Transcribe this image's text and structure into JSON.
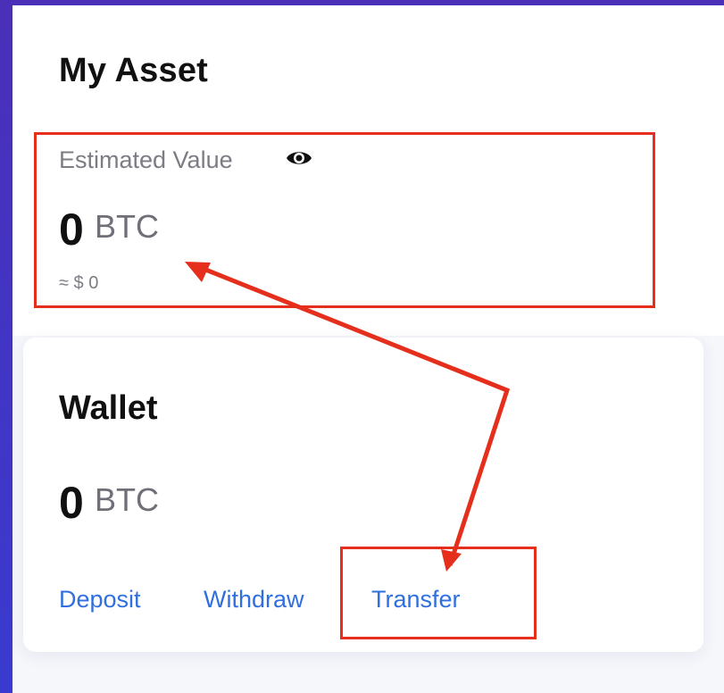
{
  "asset": {
    "title": "My Asset",
    "estimated_label": "Estimated Value",
    "amount": "0",
    "unit": "BTC",
    "fiat": "≈ $ 0",
    "visibility_icon": "eye-icon"
  },
  "wallet": {
    "title": "Wallet",
    "amount": "0",
    "unit": "BTC",
    "actions": {
      "deposit": "Deposit",
      "withdraw": "Withdraw",
      "transfer": "Transfer"
    }
  },
  "colors": {
    "link": "#2f6fe0",
    "annotation": "#e52e1c",
    "background_gradient_start": "#4a2fb8",
    "background_gradient_end": "#3a3ad0"
  }
}
